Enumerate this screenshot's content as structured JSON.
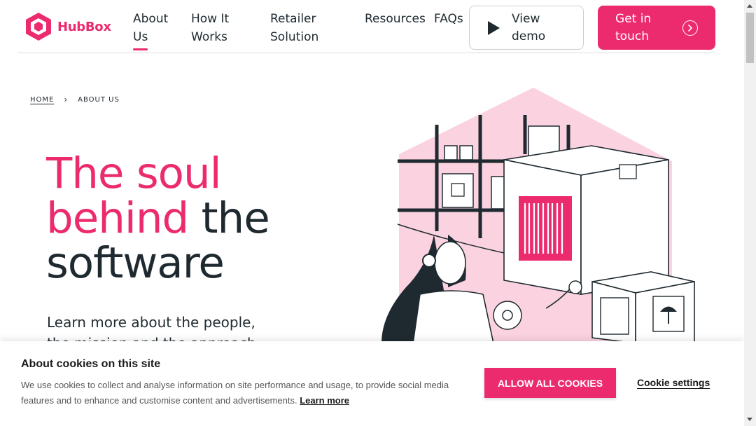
{
  "brand": {
    "name": "HubBox",
    "accent": "#ec2b6e",
    "dark": "#1f2a30"
  },
  "nav": {
    "items": [
      {
        "label_1": "About",
        "label_2": "Us",
        "active": true
      },
      {
        "label_1": "How It",
        "label_2": "Works"
      },
      {
        "label_1": "Retailer",
        "label_2": "Solution"
      },
      {
        "label_1": "Resources",
        "label_2": ""
      },
      {
        "label_1": "FAQs",
        "label_2": ""
      }
    ],
    "demo": {
      "line1": "View",
      "line2": "demo",
      "icon": "play-icon"
    },
    "contact": {
      "line1": "Get in",
      "line2": "touch",
      "icon": "chevron-right-circle-icon"
    }
  },
  "breadcrumb": {
    "home": "HOME",
    "separator": "›",
    "current": "ABOUT US"
  },
  "hero": {
    "title_line1": "The soul",
    "title_line2_pink": "behind",
    "title_line2_dark": " the",
    "title_line3": "software",
    "subtitle": "Learn more about the people, the mission and the approach"
  },
  "cookie": {
    "title": "About cookies on this site",
    "text": "We use cookies to collect and analyse information on site performance and usage, to provide social media features and to enhance and customise content and advertisements. ",
    "learn_more": "Learn more",
    "allow_all": "ALLOW ALL COOKIES",
    "settings": "Cookie settings"
  }
}
